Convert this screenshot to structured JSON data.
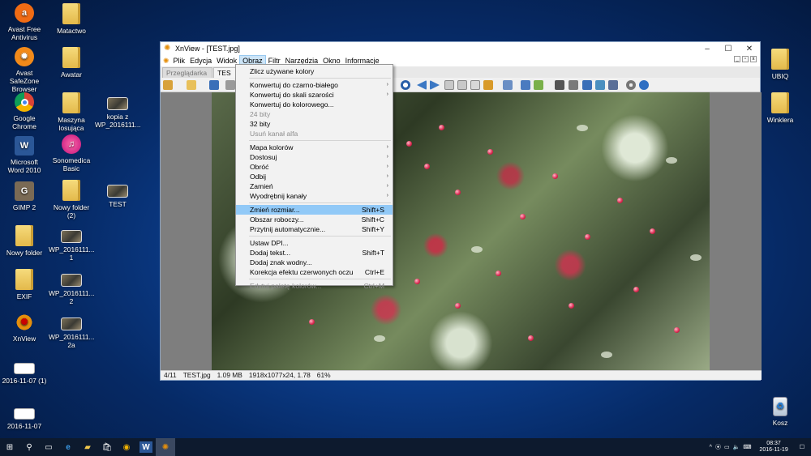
{
  "desktop": {
    "left_icons": [
      {
        "label": "Avast Free Antivirus",
        "icon": "avast-icon"
      },
      {
        "label": "Avast SafeZone Browser",
        "icon": "avast-safezone-icon"
      },
      {
        "label": "Google Chrome",
        "icon": "chrome-icon"
      },
      {
        "label": "Microsoft Word 2010",
        "icon": "word-icon"
      },
      {
        "label": "GIMP 2",
        "icon": "gimp-icon"
      },
      {
        "label": "Nowy folder",
        "icon": "folder-icon"
      },
      {
        "label": "EXIF",
        "icon": "folder-icon"
      },
      {
        "label": "XnView",
        "icon": "xnview-icon"
      },
      {
        "label": "2016-11-07 (1)",
        "icon": "image-thumb-icon"
      },
      {
        "label": "2016-11-07",
        "icon": "image-thumb-icon"
      }
    ],
    "col2_icons": [
      {
        "label": "Matactwo",
        "icon": "folder-icon"
      },
      {
        "label": "Awatar",
        "icon": "folder-icon"
      },
      {
        "label": "Maszyna losująca",
        "icon": "folder-icon"
      },
      {
        "label": "Sonomedica Basic",
        "icon": "sonomedica-icon"
      },
      {
        "label": "Nowy folder (2)",
        "icon": "folder-icon"
      },
      {
        "label": "WP_2016111... 1",
        "icon": "image-thumb-icon"
      },
      {
        "label": "WP_2016111... 2",
        "icon": "image-thumb-icon"
      },
      {
        "label": "WP_2016111... 2a",
        "icon": "image-thumb-icon"
      }
    ],
    "col3_icons": [
      {
        "label": "kopia z WP_2016111...",
        "icon": "image-thumb-icon"
      },
      {
        "label": "TEST",
        "icon": "image-thumb-icon"
      }
    ],
    "right_icons": [
      {
        "label": "UBIQ",
        "icon": "folder-icon"
      },
      {
        "label": "Winklera",
        "icon": "folder-icon"
      },
      {
        "label": "Kosz",
        "icon": "recycle-bin-icon"
      }
    ]
  },
  "window": {
    "title": "XnView - [TEST.jpg]",
    "controls": {
      "minimize": "–",
      "maximize": "☐",
      "close": "✕"
    },
    "menu": [
      "Plik",
      "Edycja",
      "Widok",
      "Obraz",
      "Filtr",
      "Narzędzia",
      "Okno",
      "Informacje"
    ],
    "active_menu": "Obraz",
    "tabs": [
      "Przeglądarka",
      "TES"
    ],
    "status": {
      "index": "4/11",
      "filename": "TEST.jpg",
      "size": "1.09 MB",
      "dims": "1918x1077x24, 1.78",
      "zoom": "61%"
    }
  },
  "obraz_menu": {
    "items": [
      {
        "label": "Zlicz używane kolory",
        "shortcut": "",
        "submenu": false,
        "disabled": false
      },
      {
        "sep": true
      },
      {
        "label": "Konwertuj do czarno-białego",
        "shortcut": "",
        "submenu": true,
        "disabled": false
      },
      {
        "label": "Konwertuj do skali szarości",
        "shortcut": "",
        "submenu": true,
        "disabled": false
      },
      {
        "label": "Konwertuj do kolorowego...",
        "shortcut": "",
        "submenu": false,
        "disabled": false
      },
      {
        "label": "24 bity",
        "shortcut": "",
        "submenu": false,
        "disabled": true
      },
      {
        "label": "32 bity",
        "shortcut": "",
        "submenu": false,
        "disabled": false
      },
      {
        "label": "Usuń kanał alfa",
        "shortcut": "",
        "submenu": false,
        "disabled": true
      },
      {
        "sep": true
      },
      {
        "label": "Mapa kolorów",
        "shortcut": "",
        "submenu": true,
        "disabled": false
      },
      {
        "label": "Dostosuj",
        "shortcut": "",
        "submenu": true,
        "disabled": false
      },
      {
        "label": "Obróć",
        "shortcut": "",
        "submenu": true,
        "disabled": false
      },
      {
        "label": "Odbij",
        "shortcut": "",
        "submenu": true,
        "disabled": false
      },
      {
        "label": "Zamień",
        "shortcut": "",
        "submenu": true,
        "disabled": false
      },
      {
        "label": "Wyodrębnij kanały",
        "shortcut": "",
        "submenu": true,
        "disabled": false
      },
      {
        "sep": true
      },
      {
        "label": "Zmień rozmiar...",
        "shortcut": "Shift+S",
        "submenu": false,
        "disabled": false,
        "highlighted": true
      },
      {
        "label": "Obszar roboczy...",
        "shortcut": "Shift+C",
        "submenu": false,
        "disabled": false
      },
      {
        "label": "Przytnij automatycznie...",
        "shortcut": "Shift+Y",
        "submenu": false,
        "disabled": false
      },
      {
        "sep": true
      },
      {
        "label": "Ustaw DPI...",
        "shortcut": "",
        "submenu": false,
        "disabled": false
      },
      {
        "label": "Dodaj tekst...",
        "shortcut": "Shift+T",
        "submenu": false,
        "disabled": false
      },
      {
        "label": "Dodaj znak wodny...",
        "shortcut": "",
        "submenu": false,
        "disabled": false
      },
      {
        "label": "Korekcja efektu czerwonych oczu",
        "shortcut": "Ctrl+E",
        "submenu": false,
        "disabled": false
      },
      {
        "sep": true
      },
      {
        "label": "Edytuj paletę kolorów...",
        "shortcut": "Ctrl+M",
        "submenu": false,
        "disabled": true
      }
    ]
  },
  "taskbar": {
    "clock_time": "08:37",
    "clock_date": "2016-11-19"
  },
  "colors": {
    "accent_highlight": "#91c9f7",
    "menu_active": "#cce4f7",
    "taskbar": "#0d1a2e"
  }
}
